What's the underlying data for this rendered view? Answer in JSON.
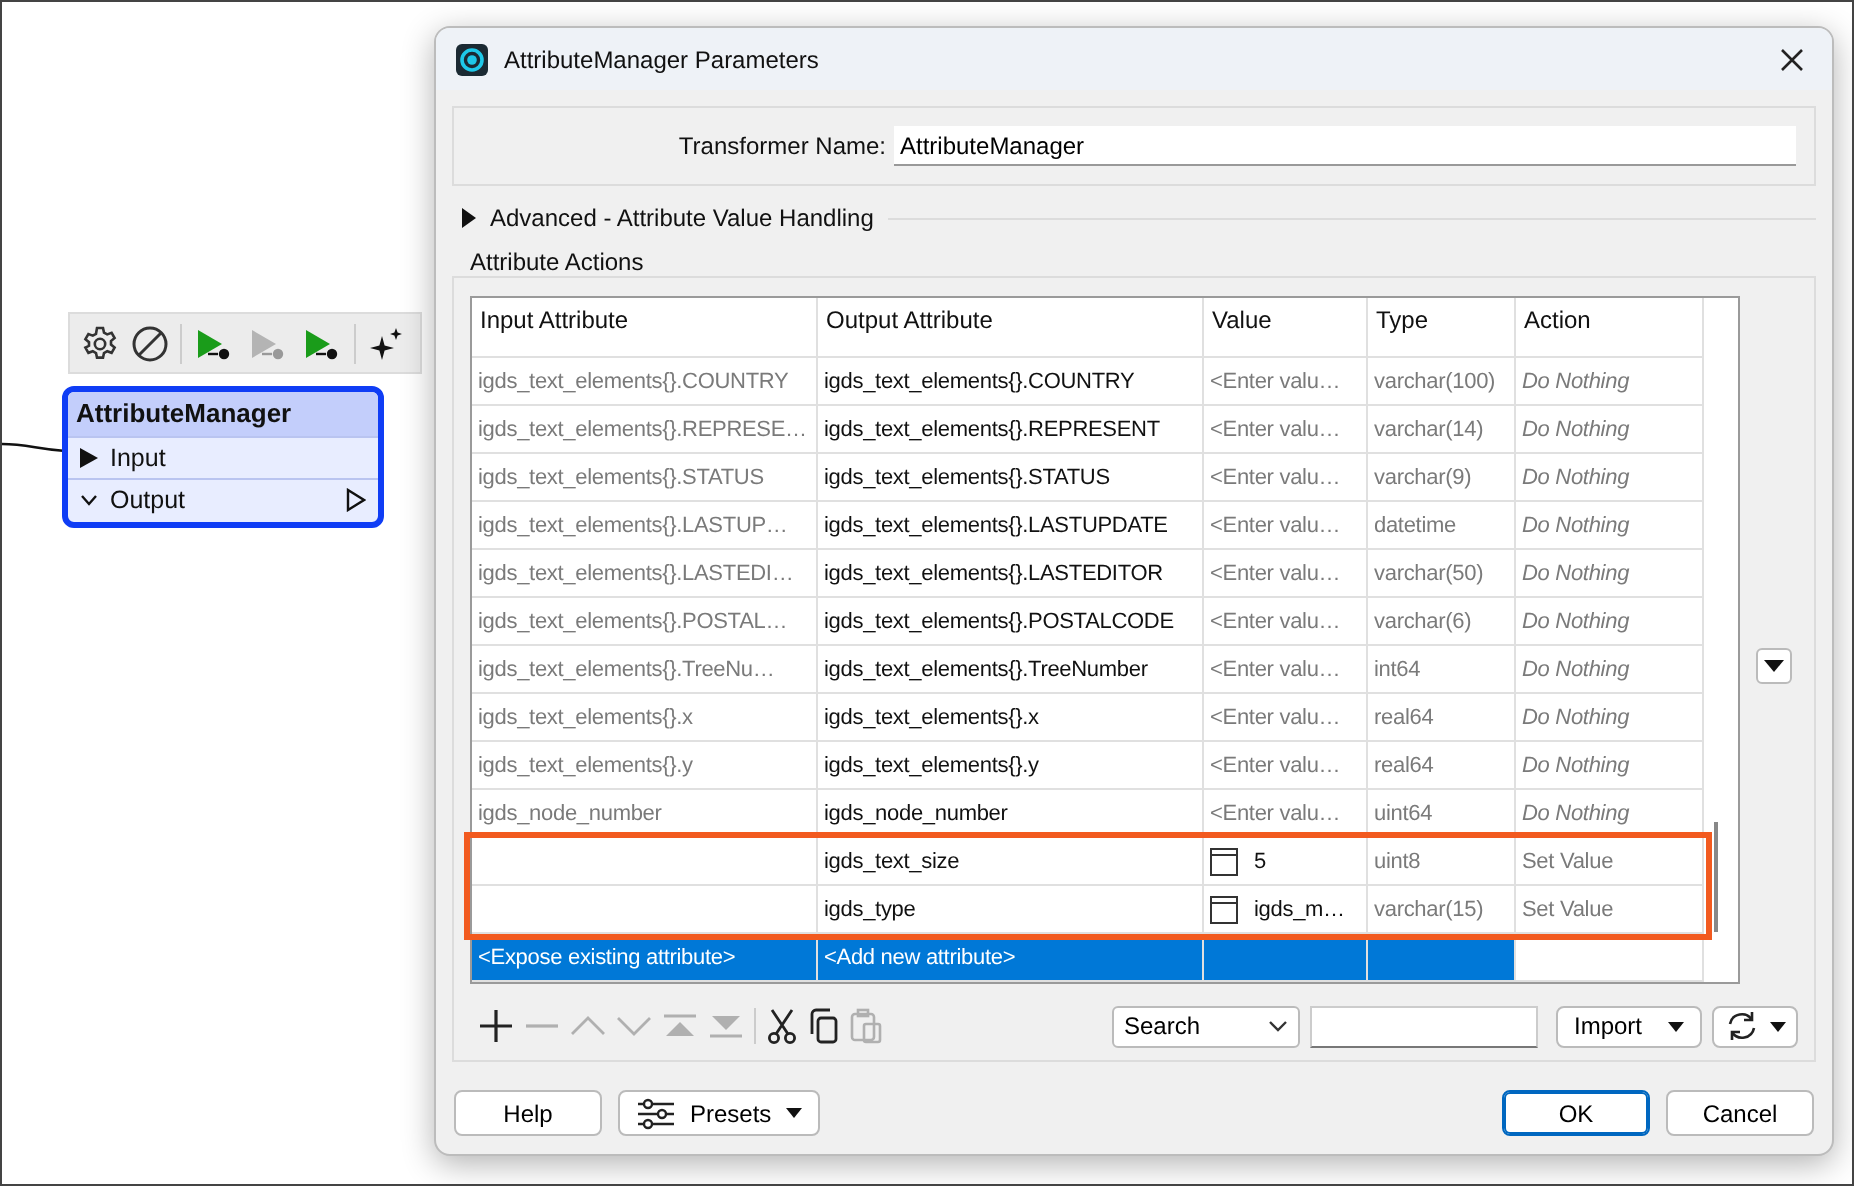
{
  "canvas": {
    "node_toolbar": [
      {
        "kind": "settings",
        "disabled": false
      },
      {
        "kind": "disable",
        "disabled": false
      },
      {
        "kind": "run",
        "disabled": false
      },
      {
        "kind": "run",
        "disabled": true
      },
      {
        "kind": "run",
        "disabled": false
      },
      {
        "kind": "sparkle",
        "disabled": false
      }
    ],
    "node": {
      "title": "AttributeManager",
      "selected": true,
      "ports": [
        {
          "kind": "input",
          "label": "Input"
        },
        {
          "kind": "output",
          "label": "Output"
        }
      ]
    }
  },
  "dialog": {
    "title": "AttributeManager Parameters",
    "transformer_name": {
      "label": "Transformer Name:",
      "value": "AttributeManager"
    },
    "advanced": {
      "label": "Advanced - Attribute Value Handling",
      "expanded": false
    },
    "attribute_actions": {
      "title": "Attribute Actions",
      "columns": [
        "Input Attribute",
        "Output Attribute",
        "Value",
        "Type",
        "Action"
      ],
      "rows": [
        {
          "kind": "existing",
          "input": "igds_text_elements{}.COUNTRY",
          "output": "igds_text_elements{}.COUNTRY",
          "value": {
            "placeholder": "<Enter valu…"
          },
          "type": "varchar(100)",
          "action": "Do Nothing",
          "highlighted": false,
          "selected": false
        },
        {
          "kind": "existing",
          "input": "igds_text_elements{}.REPRESE…",
          "output": "igds_text_elements{}.REPRESENT",
          "value": {
            "placeholder": "<Enter valu…"
          },
          "type": "varchar(14)",
          "action": "Do Nothing",
          "highlighted": false,
          "selected": false
        },
        {
          "kind": "existing",
          "input": "igds_text_elements{}.STATUS",
          "output": "igds_text_elements{}.STATUS",
          "value": {
            "placeholder": "<Enter valu…"
          },
          "type": "varchar(9)",
          "action": "Do Nothing",
          "highlighted": false,
          "selected": false
        },
        {
          "kind": "existing",
          "input": "igds_text_elements{}.LASTUP…",
          "output": "igds_text_elements{}.LASTUPDATE",
          "value": {
            "placeholder": "<Enter valu…"
          },
          "type": "datetime",
          "action": "Do Nothing",
          "highlighted": false,
          "selected": false
        },
        {
          "kind": "existing",
          "input": "igds_text_elements{}.LASTEDI…",
          "output": "igds_text_elements{}.LASTEDITOR",
          "value": {
            "placeholder": "<Enter valu…"
          },
          "type": "varchar(50)",
          "action": "Do Nothing",
          "highlighted": false,
          "selected": false
        },
        {
          "kind": "existing",
          "input": "igds_text_elements{}.POSTAL…",
          "output": "igds_text_elements{}.POSTALCODE",
          "value": {
            "placeholder": "<Enter valu…"
          },
          "type": "varchar(6)",
          "action": "Do Nothing",
          "highlighted": false,
          "selected": false
        },
        {
          "kind": "existing",
          "input": "igds_text_elements{}.TreeNu…",
          "output": "igds_text_elements{}.TreeNumber",
          "value": {
            "placeholder": "<Enter valu…"
          },
          "type": "int64",
          "action": "Do Nothing",
          "highlighted": false,
          "selected": false
        },
        {
          "kind": "existing",
          "input": "igds_text_elements{}.x",
          "output": "igds_text_elements{}.x",
          "value": {
            "placeholder": "<Enter valu…"
          },
          "type": "real64",
          "action": "Do Nothing",
          "highlighted": false,
          "selected": false
        },
        {
          "kind": "existing",
          "input": "igds_text_elements{}.y",
          "output": "igds_text_elements{}.y",
          "value": {
            "placeholder": "<Enter valu…"
          },
          "type": "real64",
          "action": "Do Nothing",
          "highlighted": false,
          "selected": false
        },
        {
          "kind": "existing",
          "input": "igds_node_number",
          "output": "igds_node_number",
          "value": {
            "placeholder": "<Enter valu…"
          },
          "type": "uint64",
          "action": "Do Nothing",
          "highlighted": false,
          "selected": false
        },
        {
          "kind": "new",
          "output": "igds_text_size",
          "value": {
            "text": "5"
          },
          "type": "uint8",
          "action": "Set Value",
          "highlighted": true,
          "selected": false
        },
        {
          "kind": "new",
          "output": "igds_type",
          "value": {
            "text": "igds_m…"
          },
          "type": "varchar(15)",
          "action": "Set Value",
          "highlighted": true,
          "selected": false
        },
        {
          "kind": "add",
          "input": "<Expose existing attribute>",
          "output": "<Add new attribute>",
          "highlighted": false,
          "selected": true
        }
      ],
      "tools": [
        {
          "kind": "add",
          "disabled": false
        },
        {
          "kind": "remove",
          "disabled": true
        },
        {
          "kind": "up",
          "disabled": true
        },
        {
          "kind": "down",
          "disabled": true
        },
        {
          "kind": "top",
          "disabled": true
        },
        {
          "kind": "bottom",
          "disabled": true
        },
        {
          "kind": "cut",
          "disabled": false
        },
        {
          "kind": "copy",
          "disabled": false
        },
        {
          "kind": "paste",
          "disabled": true
        }
      ],
      "search_mode": "Search",
      "import_button": "Import"
    },
    "buttons": [
      {
        "kind": "help",
        "label": "Help",
        "default": false
      },
      {
        "kind": "presets",
        "label": "Presets",
        "default": false
      },
      {
        "kind": "ok",
        "label": "OK",
        "default": true
      },
      {
        "kind": "cancel",
        "label": "Cancel",
        "default": false
      }
    ]
  }
}
